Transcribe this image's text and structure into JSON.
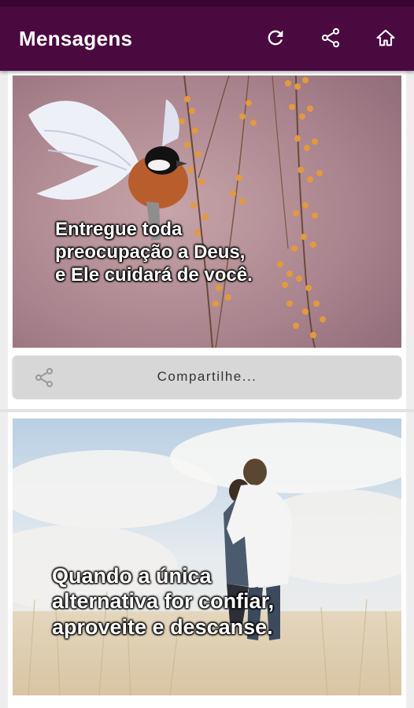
{
  "appbar": {
    "title": "Mensagens",
    "actions": [
      {
        "icon": "refresh-icon"
      },
      {
        "icon": "share-icon"
      },
      {
        "icon": "home-icon"
      }
    ],
    "background_color": "#4a0a3f"
  },
  "messages": [
    {
      "quote_lines": [
        "Entregue toda",
        "preocupação a Deus,",
        "e Ele cuidará de você."
      ],
      "image": "bird-on-branch",
      "share_label": "Compartilhe..."
    },
    {
      "quote_lines": [
        "Quando a única",
        "alternativa for confiar,",
        "aproveite e descanse."
      ],
      "image": "couple-in-field"
    }
  ]
}
